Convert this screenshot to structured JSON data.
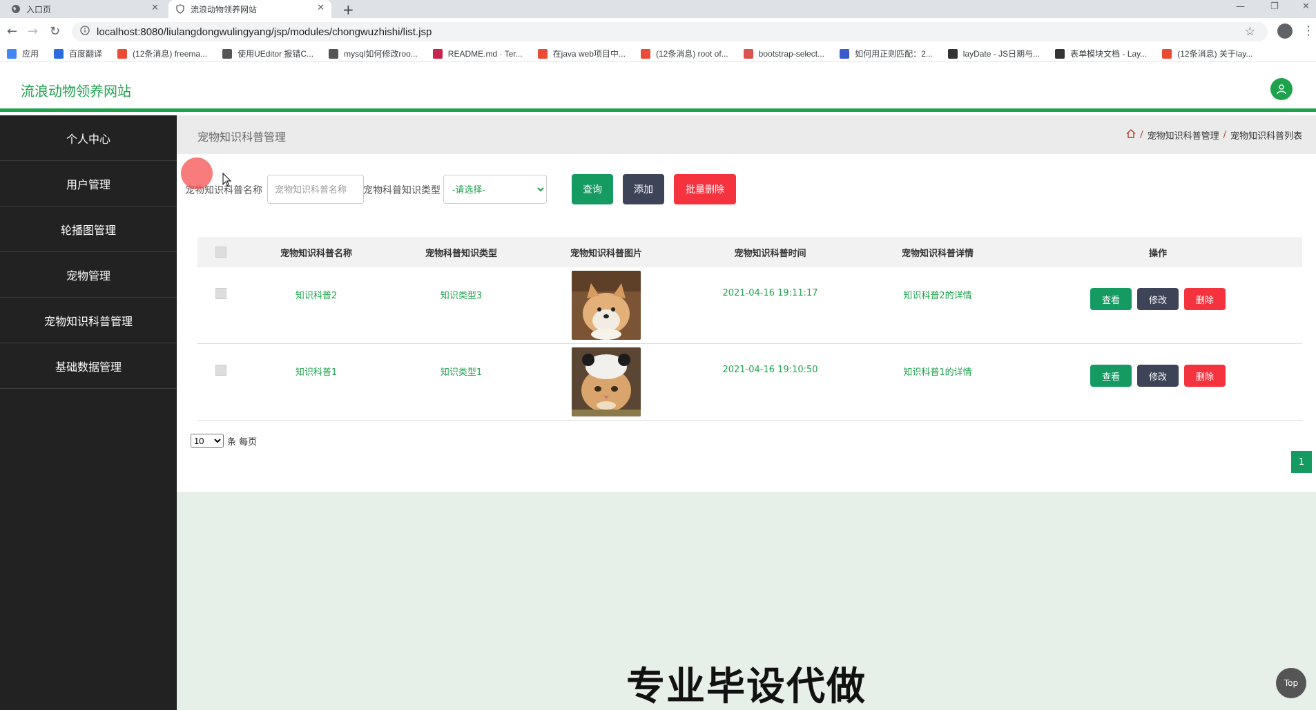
{
  "browser": {
    "tabs": [
      {
        "title": "入口页",
        "active": false
      },
      {
        "title": "流浪动物领养网站",
        "active": true
      }
    ],
    "url": "localhost:8080/liulangdongwulingyang/jsp/modules/chongwuzhishi/list.jsp",
    "bookmarks": [
      {
        "label": "应用",
        "color": "#4285f4"
      },
      {
        "label": "百度翻译",
        "color": "#2b6de0"
      },
      {
        "label": "(12条消息) freema...",
        "color": "#e94b35"
      },
      {
        "label": "使用UEditor 报错C...",
        "color": "#555555"
      },
      {
        "label": "mysql如何修改roo...",
        "color": "#555555"
      },
      {
        "label": "README.md · Ter...",
        "color": "#c7254e"
      },
      {
        "label": "在java web项目中...",
        "color": "#e94b35"
      },
      {
        "label": "(12条消息) root of...",
        "color": "#e94b35"
      },
      {
        "label": "bootstrap-select...",
        "color": "#d9534f"
      },
      {
        "label": "如何用正则匹配：2...",
        "color": "#3a5bcd"
      },
      {
        "label": "layDate - JS日期与...",
        "color": "#333333"
      },
      {
        "label": "表单模块文档 - Lay...",
        "color": "#333333"
      },
      {
        "label": "(12条消息) 关于lay...",
        "color": "#e94b35"
      }
    ]
  },
  "header": {
    "site_title": "流浪动物领养网站",
    "accent_color": "#1ea34d"
  },
  "sidebar": {
    "items": [
      {
        "label": "个人中心"
      },
      {
        "label": "用户管理"
      },
      {
        "label": "轮播图管理"
      },
      {
        "label": "宠物管理"
      },
      {
        "label": "宠物知识科普管理"
      },
      {
        "label": "基础数据管理"
      }
    ]
  },
  "page": {
    "title": "宠物知识科普管理",
    "breadcrumb": [
      "宠物知识科普管理",
      "宠物知识科普列表"
    ]
  },
  "search": {
    "name_label": "宠物知识科普名称",
    "name_placeholder": "宠物知识科普名称",
    "type_label": "宠物科普知识类型",
    "type_selected": "-请选择-",
    "query_label": "查询",
    "add_label": "添加",
    "batch_delete_label": "批量删除"
  },
  "table": {
    "columns": [
      "宠物知识科普名称",
      "宠物科普知识类型",
      "宠物知识科普图片",
      "宠物知识科普时间",
      "宠物知识科普详情",
      "操作"
    ],
    "rows": [
      {
        "name": "知识科普2",
        "type": "知识类型3",
        "image": "shiba-dog-photo",
        "time": "2021-04-16 19:11:17",
        "detail": "知识科普2的详情"
      },
      {
        "name": "知识科普1",
        "type": "知识类型1",
        "image": "cat-with-hat-photo",
        "time": "2021-04-16 19:10:50",
        "detail": "知识科普1的详情"
      }
    ],
    "ops": {
      "view": "查看",
      "edit": "修改",
      "delete": "删除"
    }
  },
  "pagination": {
    "page_size": "10",
    "page_size_suffix": "条 每页",
    "current_page": "1"
  },
  "banner": "专业毕设代做",
  "top_button": "Top"
}
